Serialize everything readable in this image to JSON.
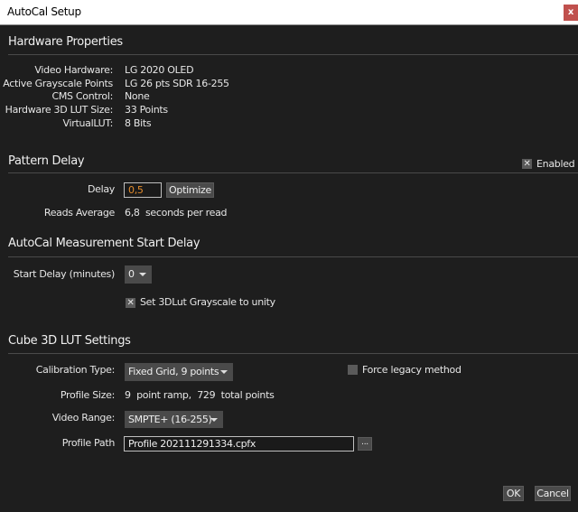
{
  "window": {
    "title": "AutoCal Setup",
    "close": "x"
  },
  "hardware": {
    "title": "Hardware Properties",
    "rows": [
      {
        "label": "Video Hardware:",
        "value": "LG 2020 OLED"
      },
      {
        "label": "Active Grayscale Points",
        "value": "LG 26 pts SDR 16-255"
      },
      {
        "label": "CMS Control:",
        "value": "None"
      },
      {
        "label": "Hardware 3D LUT Size:",
        "value": "33 Points"
      },
      {
        "label": "VirtualLUT:",
        "value": "8 Bits"
      }
    ]
  },
  "pattern": {
    "title": "Pattern Delay",
    "enabled_label": "Enabled",
    "enabled": true,
    "delay_label": "Delay",
    "delay_value": "0,5",
    "optimize": "Optimize",
    "reads_label": "Reads Average",
    "reads_value": "6,8",
    "reads_unit": "seconds per read"
  },
  "start": {
    "title": "AutoCal Measurement Start Delay",
    "label": "Start Delay (minutes)",
    "value": "0",
    "unity_label": "Set 3DLut Grayscale to unity",
    "unity": true
  },
  "cube": {
    "title": "Cube 3D LUT Settings",
    "cal_label": "Calibration Type:",
    "cal_value": "Fixed Grid, 9 points",
    "legacy_label": "Force legacy method",
    "legacy": false,
    "size_label": "Profile Size:",
    "size_value": "9  point ramp,  729  total points",
    "range_label": "Video Range:",
    "range_value": "SMPTE+ (16-255)",
    "path_label": "Profile Path",
    "path_value": "Profile 202111291334.cpfx",
    "browse": "..."
  },
  "footer": {
    "ok": "OK",
    "cancel": "Cancel"
  }
}
